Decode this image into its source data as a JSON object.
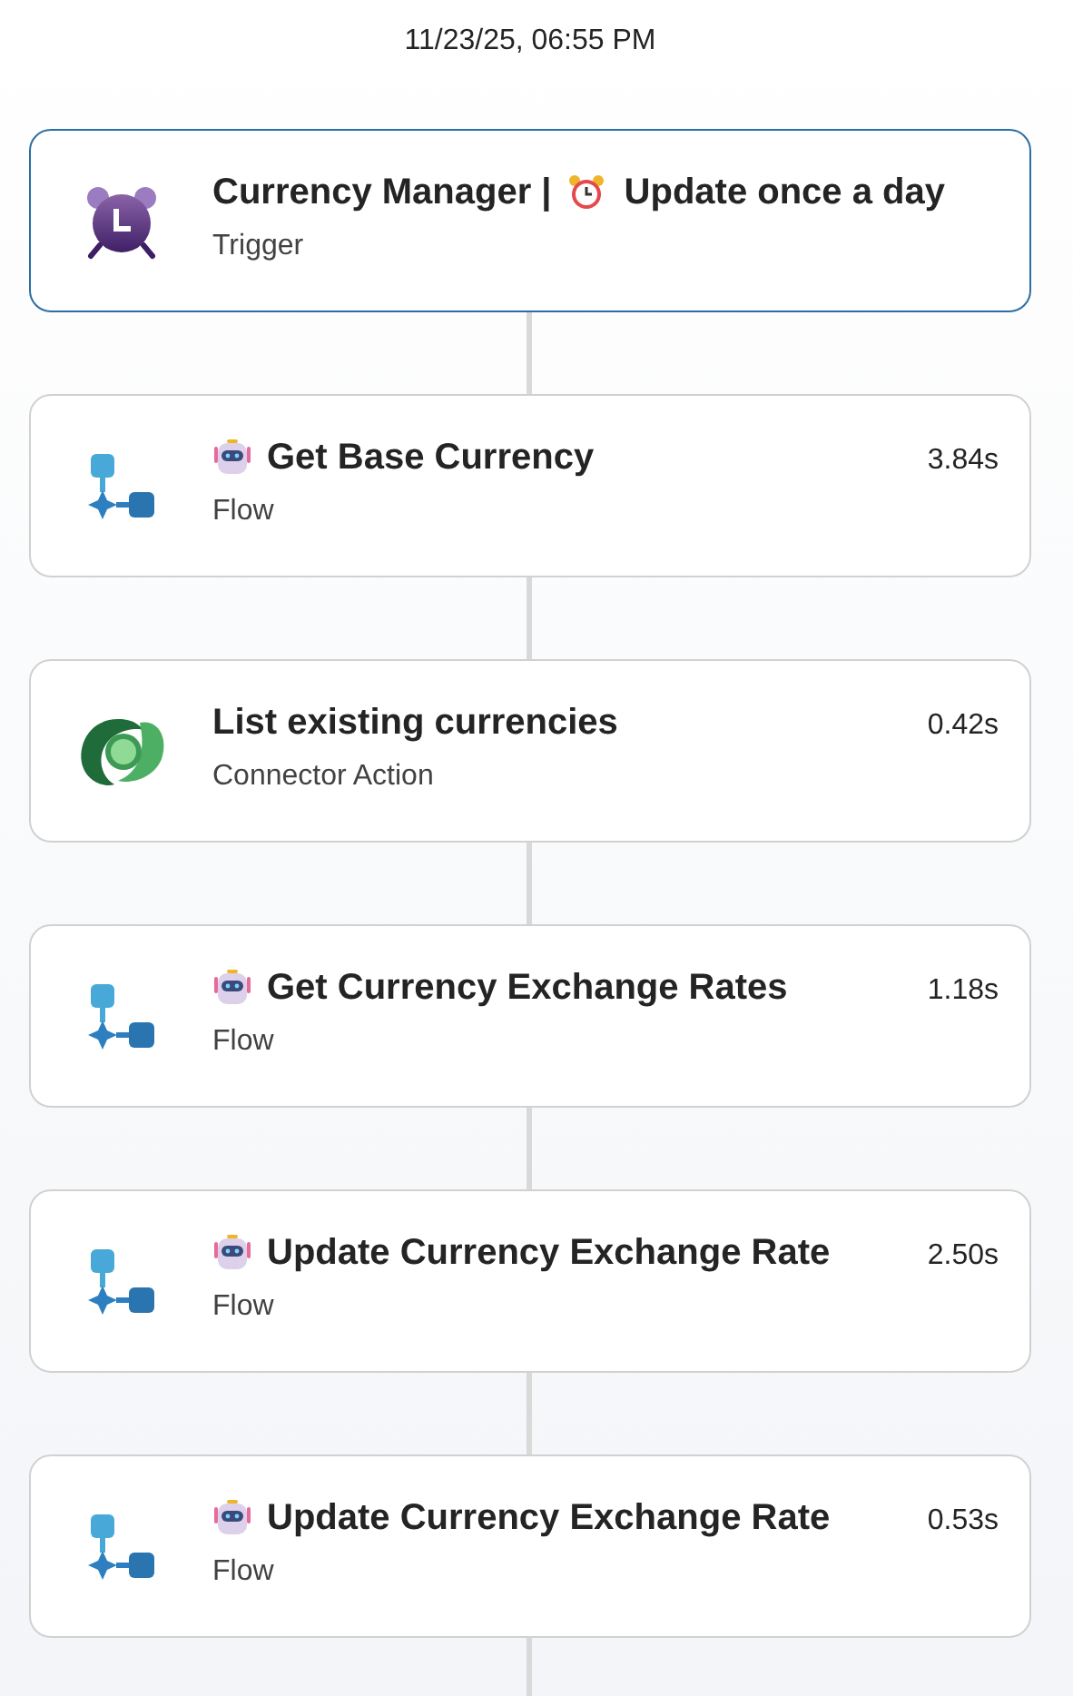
{
  "timestamp": "11/23/25, 06:55 PM",
  "steps": [
    {
      "kind": "trigger",
      "title": "Currency Manager |",
      "schedule": "Update once a day",
      "subtitle": "Trigger",
      "selected": true
    },
    {
      "kind": "flow",
      "title": "Get Base Currency",
      "subtitle": "Flow",
      "duration": "3.84s",
      "selected": false
    },
    {
      "kind": "connector",
      "title": "List existing currencies",
      "subtitle": "Connector Action",
      "duration": "0.42s",
      "selected": false
    },
    {
      "kind": "flow",
      "title": "Get Currency Exchange Rates",
      "subtitle": "Flow",
      "duration": "1.18s",
      "selected": false
    },
    {
      "kind": "flow",
      "title": "Update Currency Exchange Rate",
      "subtitle": "Flow",
      "duration": "2.50s",
      "selected": false
    },
    {
      "kind": "flow",
      "title": "Update Currency Exchange Rate",
      "subtitle": "Flow",
      "duration": "0.53s",
      "selected": false
    }
  ]
}
